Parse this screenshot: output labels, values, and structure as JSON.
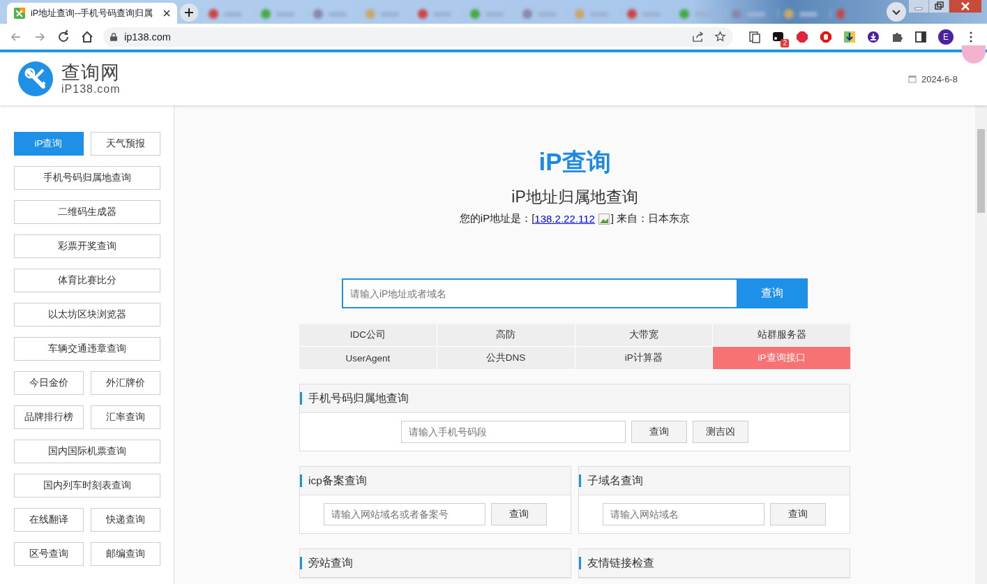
{
  "browser": {
    "tab": {
      "title": "iP地址查询--手机号码查询归属",
      "selected": true
    },
    "url": "ip138.com",
    "extension_badge": "2",
    "profile": "E"
  },
  "header": {
    "logo_name": "查询网",
    "logo_domain": "iP138.com",
    "date": "2024-6-8"
  },
  "sidebar": {
    "rows": [
      [
        {
          "label": "iP查询",
          "selected": true
        },
        {
          "label": "天气预报",
          "selected": false
        }
      ],
      [
        {
          "label": "手机号码归属地查询",
          "selected": false
        }
      ],
      [
        {
          "label": "二维码生成器",
          "selected": false
        }
      ],
      [
        {
          "label": "彩票开奖查询",
          "selected": false
        }
      ],
      [
        {
          "label": "体育比赛比分",
          "selected": false
        }
      ],
      [
        {
          "label": "以太坊区块浏览器",
          "selected": false
        }
      ],
      [
        {
          "label": "车辆交通违章查询",
          "selected": false
        }
      ],
      [
        {
          "label": "今日金价",
          "selected": false
        },
        {
          "label": "外汇牌价",
          "selected": false
        }
      ],
      [
        {
          "label": "品牌排行榜",
          "selected": false
        },
        {
          "label": "汇率查询",
          "selected": false
        }
      ],
      [
        {
          "label": "国内国际机票查询",
          "selected": false
        }
      ],
      [
        {
          "label": "国内列车时刻表查询",
          "selected": false
        }
      ],
      [
        {
          "label": "在线翻译",
          "selected": false
        },
        {
          "label": "快递查询",
          "selected": false
        }
      ],
      [
        {
          "label": "区号查询",
          "selected": false
        },
        {
          "label": "邮编查询",
          "selected": false
        }
      ]
    ]
  },
  "main": {
    "title": "iP查询",
    "subtitle": "iP地址归属地查询",
    "ip_prefix": "您的iP地址是：[",
    "ip": "138.2.22.112",
    "ip_suffix": "] 来自：日本东京",
    "search": {
      "placeholder": "请输入iP地址或者域名",
      "button": "查询"
    },
    "links": [
      {
        "label": "IDC公司",
        "highlighted": false
      },
      {
        "label": "高防",
        "highlighted": false
      },
      {
        "label": "大带宽",
        "highlighted": false
      },
      {
        "label": "站群服务器",
        "highlighted": false
      },
      {
        "label": "UserAgent",
        "highlighted": false
      },
      {
        "label": "公共DNS",
        "highlighted": false
      },
      {
        "label": "iP计算器",
        "highlighted": false
      },
      {
        "label": "iP查询接口",
        "highlighted": true
      }
    ],
    "panels": [
      {
        "kind": "wide",
        "title": "手机号码归属地查询",
        "placeholder": "请输入手机号码段",
        "buttons": [
          "查询",
          "测吉凶"
        ]
      },
      {
        "kind": "half",
        "title": "icp备案查询",
        "placeholder": "请输入网站域名或者备案号",
        "buttons": [
          "查询"
        ]
      },
      {
        "kind": "half",
        "title": "子域名查询",
        "placeholder": "请输入网站域名",
        "buttons": [
          "查询"
        ]
      },
      {
        "kind": "half",
        "title": "旁站查询"
      },
      {
        "kind": "half",
        "title": "友情链接检查"
      }
    ]
  }
}
